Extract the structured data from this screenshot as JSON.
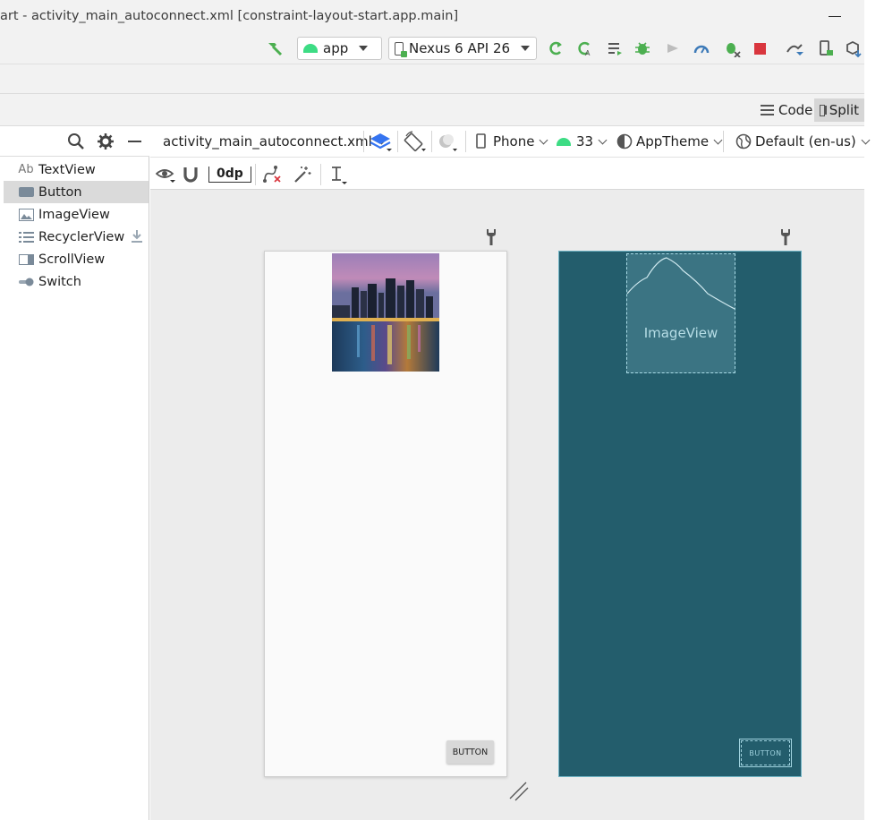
{
  "window": {
    "title": "art - activity_main_autoconnect.xml [constraint-layout-start.app.main]"
  },
  "runbar": {
    "config_select": "app",
    "device_select": "Nexus 6 API 26",
    "icons": [
      "build-hammer-icon",
      "run-icon",
      "apply-changes-icon",
      "apply-code-changes-icon",
      "debug-icon",
      "profile-icon",
      "attach-debugger-icon",
      "stop-icon",
      "sync-project-icon",
      "device-manager-icon",
      "sdk-manager-icon"
    ]
  },
  "view_modes": {
    "code_label": "Code",
    "split_label": "Split"
  },
  "palette": {
    "items": [
      {
        "label": "TextView",
        "icon": "textview-icon",
        "icon_text": "Ab"
      },
      {
        "label": "Button",
        "icon": "button-icon"
      },
      {
        "label": "ImageView",
        "icon": "imageview-icon"
      },
      {
        "label": "RecyclerView",
        "icon": "recyclerview-icon"
      },
      {
        "label": "ScrollView",
        "icon": "scrollview-icon"
      },
      {
        "label": "Switch",
        "icon": "switch-icon"
      }
    ],
    "selected": "Button"
  },
  "editor_toolbar": {
    "file": "activity_main_autoconnect.xml",
    "device": "Phone",
    "api": "33",
    "theme": "AppTheme",
    "locale": "Default (en-us)",
    "default_margin": "0dp"
  },
  "design_surface": {
    "button_text": "BUTTON",
    "blueprint_image_label": "ImageView",
    "blueprint_button_text": "BUTTON"
  },
  "colors": {
    "blueprint_bg": "#235d6c",
    "blueprint_line": "#a9dbe6",
    "android_green": "#3ddc84",
    "run_green": "#4caf50",
    "stop_red": "#d9363e"
  }
}
